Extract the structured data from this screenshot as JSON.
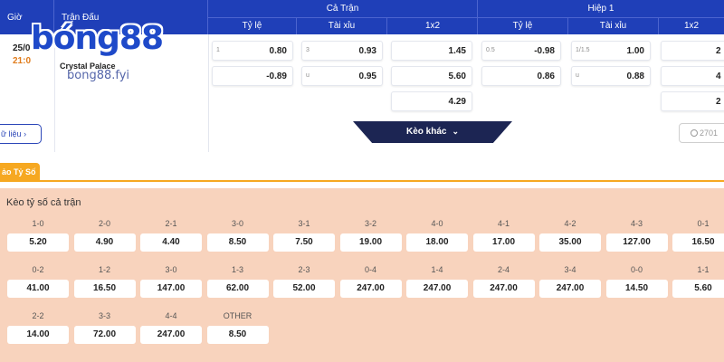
{
  "header": {
    "col_gio": "Giờ",
    "col_tran_dau": "Trận Đấu",
    "ca_tran": {
      "title": "Cả Trận",
      "ty_le": "Tỷ lệ",
      "tai_xiu": "Tài xỉu",
      "one_x_two": "1x2"
    },
    "hiep1": {
      "title": "Hiệp 1",
      "ty_le": "Tỷ lệ",
      "tai_xiu": "Tài xỉu",
      "one_x_two": "1x2"
    }
  },
  "match": {
    "date": "25/0",
    "time": "21:0",
    "team": "Crystal Palace",
    "logo_text": "bóng88",
    "watermark": "bong88.fyi"
  },
  "odds": {
    "ca_tran": {
      "ty_le": [
        {
          "h": "1",
          "v": "0.80"
        },
        {
          "h": "",
          "v": "-0.89"
        }
      ],
      "tai_xiu": [
        {
          "h": "3",
          "v": "0.93"
        },
        {
          "h": "u",
          "v": "0.95"
        }
      ],
      "one_x_two": [
        {
          "v": "1.45"
        },
        {
          "v": "5.60"
        },
        {
          "v": "4.29"
        }
      ]
    },
    "hiep1": {
      "ty_le": [
        {
          "h": "0.5",
          "v": "-0.98"
        },
        {
          "h": "",
          "v": "0.86"
        }
      ],
      "tai_xiu": [
        {
          "h": "1/1.5",
          "v": "1.00"
        },
        {
          "h": "u",
          "v": "0.88"
        }
      ],
      "one_x_two": [
        {
          "v": "2"
        },
        {
          "v": "4"
        },
        {
          "v": "2"
        }
      ]
    }
  },
  "buttons": {
    "du_lieu": "ữ liệu",
    "du_lieu_chevron": "›",
    "keo_khac": "Kèo khác",
    "keo_khac_chevron": "⌄",
    "count": "2701"
  },
  "tab": {
    "label": "ảo Tỷ Số"
  },
  "panel": {
    "title": "Kèo tỷ số cả trận",
    "rows": [
      [
        {
          "s": "1-0",
          "o": "5.20"
        },
        {
          "s": "2-0",
          "o": "4.90"
        },
        {
          "s": "2-1",
          "o": "4.40"
        },
        {
          "s": "3-0",
          "o": "8.50"
        },
        {
          "s": "3-1",
          "o": "7.50"
        },
        {
          "s": "3-2",
          "o": "19.00"
        },
        {
          "s": "4-0",
          "o": "18.00"
        },
        {
          "s": "4-1",
          "o": "17.00"
        },
        {
          "s": "4-2",
          "o": "35.00"
        },
        {
          "s": "4-3",
          "o": "127.00"
        },
        {
          "s": "0-1",
          "o": "16.50"
        }
      ],
      [
        {
          "s": "0-2",
          "o": "41.00"
        },
        {
          "s": "1-2",
          "o": "16.50"
        },
        {
          "s": "3-0",
          "o": "147.00"
        },
        {
          "s": "1-3",
          "o": "62.00"
        },
        {
          "s": "2-3",
          "o": "52.00"
        },
        {
          "s": "0-4",
          "o": "247.00"
        },
        {
          "s": "1-4",
          "o": "247.00"
        },
        {
          "s": "2-4",
          "o": "247.00"
        },
        {
          "s": "3-4",
          "o": "247.00"
        },
        {
          "s": "0-0",
          "o": "14.50"
        },
        {
          "s": "1-1",
          "o": "5.60"
        }
      ],
      [
        {
          "s": "2-2",
          "o": "14.00"
        },
        {
          "s": "3-3",
          "o": "72.00"
        },
        {
          "s": "4-4",
          "o": "247.00"
        },
        {
          "s": "OTHER",
          "o": "8.50"
        }
      ]
    ]
  },
  "colors": {
    "header": "#1f3fb8",
    "accent": "#f6a821",
    "panel": "#f8d3bd",
    "time": "#e07b1a",
    "dark_button": "#1c2553"
  }
}
